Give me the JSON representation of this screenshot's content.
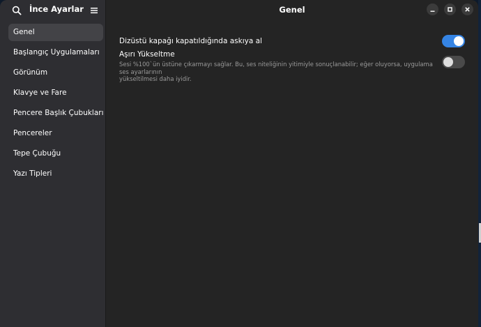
{
  "app": {
    "title": "İnce Ayarlar",
    "page_title": "Genel"
  },
  "sidebar": {
    "items": [
      {
        "label": "Genel",
        "active": true
      },
      {
        "label": "Başlangıç Uygulamaları",
        "active": false
      },
      {
        "label": "Görünüm",
        "active": false
      },
      {
        "label": "Klavye ve Fare",
        "active": false
      },
      {
        "label": "Pencere Başlık Çubukları",
        "active": false
      },
      {
        "label": "Pencereler",
        "active": false
      },
      {
        "label": "Tepe Çubuğu",
        "active": false
      },
      {
        "label": "Yazı Tipleri",
        "active": false
      }
    ]
  },
  "settings": {
    "suspend": {
      "label": "Dizüstü kapağı kapatıldığında askıya al",
      "enabled": true
    },
    "overamplification": {
      "label": "Aşırı Yükseltme",
      "description_line1": "Sesi %100`ün üstüne çıkarmayı sağlar. Bu, ses niteliğinin yitimiyle sonuçlanabilir; eğer oluyorsa, uygulama ses ayarlarının",
      "description_line2": "yükseltilmesi daha iyidir.",
      "enabled": false
    }
  },
  "icons": {
    "search": "search-icon",
    "menu": "hamburger-menu-icon",
    "minimize": "minimize-icon",
    "maximize": "maximize-icon",
    "close": "close-icon"
  },
  "colors": {
    "accent": "#3584e4",
    "sidebar_bg": "#2e2e32",
    "content_bg": "#242424",
    "active_item": "#434347"
  }
}
